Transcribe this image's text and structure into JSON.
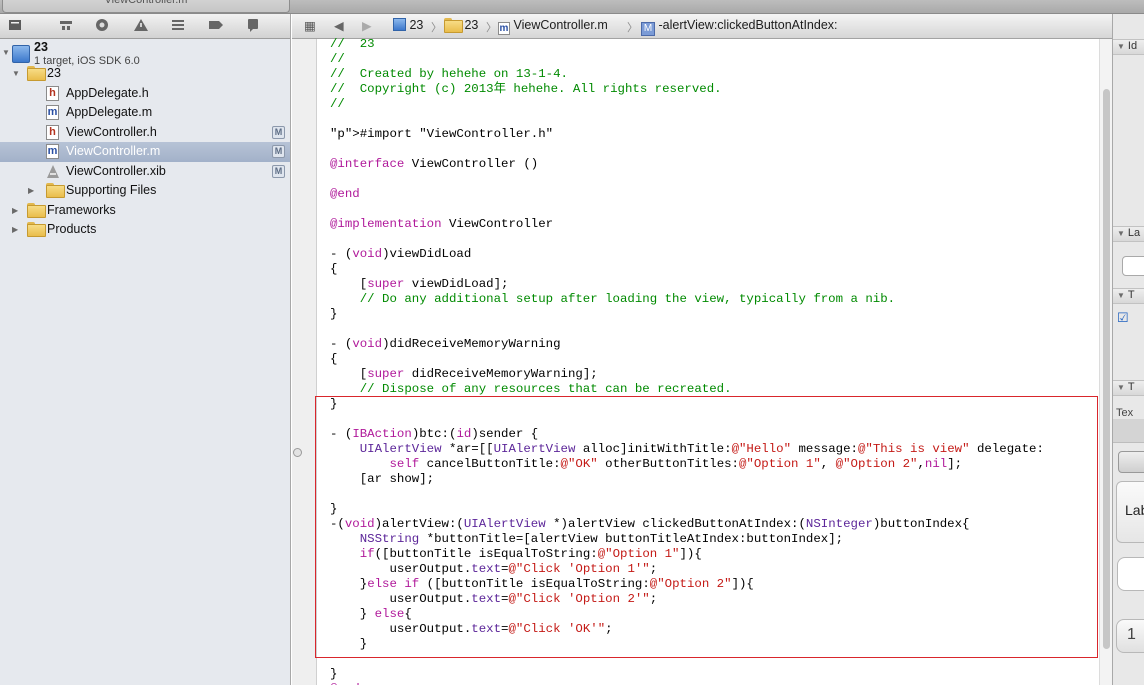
{
  "window": {
    "tab_title": "ViewController.m"
  },
  "navigator": {
    "project": {
      "name": "23",
      "subtitle": "1 target, iOS SDK 6.0"
    },
    "items": [
      {
        "label": "23",
        "kind": "folder",
        "badge": ""
      },
      {
        "label": "AppDelegate.h",
        "kind": "h",
        "badge": ""
      },
      {
        "label": "AppDelegate.m",
        "kind": "m",
        "badge": ""
      },
      {
        "label": "ViewController.h",
        "kind": "h",
        "badge": "M"
      },
      {
        "label": "ViewController.m",
        "kind": "m",
        "badge": "M"
      },
      {
        "label": "ViewController.xib",
        "kind": "xib",
        "badge": "M"
      },
      {
        "label": "Supporting Files",
        "kind": "folder",
        "badge": ""
      },
      {
        "label": "Frameworks",
        "kind": "folder",
        "badge": ""
      },
      {
        "label": "Products",
        "kind": "folder",
        "badge": ""
      }
    ]
  },
  "jumpbar": {
    "items": [
      "23",
      "23",
      "ViewController.m",
      "-alertView:clickedButtonAtIndex:"
    ],
    "method_badge": "M"
  },
  "editor": {
    "code_lines": [
      "//  23",
      "//",
      "//  Created by hehehe on 13-1-4.",
      "//  Copyright (c) 2013年 hehehe. All rights reserved.",
      "//",
      "",
      "#import \"ViewController.h\"",
      "",
      "@interface ViewController ()",
      "",
      "@end",
      "",
      "@implementation ViewController",
      "",
      "- (void)viewDidLoad",
      "{",
      "    [super viewDidLoad];",
      "    // Do any additional setup after loading the view, typically from a nib.",
      "}",
      "",
      "- (void)didReceiveMemoryWarning",
      "{",
      "    [super didReceiveMemoryWarning];",
      "    // Dispose of any resources that can be recreated.",
      "}",
      "",
      "- (IBAction)btc:(id)sender {",
      "    UIAlertView *ar=[[UIAlertView alloc]initWithTitle:@\"Hello\" message:@\"This is view\" delegate:",
      "        self cancelButtonTitle:@\"OK\" otherButtonTitles:@\"Option 1\", @\"Option 2\",nil];",
      "    [ar show];",
      "",
      "}",
      "-(void)alertView:(UIAlertView *)alertView clickedButtonAtIndex:(NSInteger)buttonIndex{",
      "    NSString *buttonTitle=[alertView buttonTitleAtIndex:buttonIndex];",
      "    if([buttonTitle isEqualToString:@\"Option 1\"]){",
      "        userOutput.text=@\"Click 'Option 1'\";",
      "    }else if ([buttonTitle isEqualToString:@\"Option 2\"]){",
      "        userOutput.text=@\"Click 'Option 2'\";",
      "    } else{",
      "        userOutput.text=@\"Click 'OK'\";",
      "    }",
      "",
      "}",
      "@end"
    ]
  },
  "utilities": {
    "sections": [
      "Id",
      "La",
      "T",
      "T"
    ],
    "text_label": "Tex",
    "label_button": "Lab",
    "stepper_value": "1"
  },
  "colors": {
    "comment": "#008a00",
    "keyword": "#b0199a",
    "string": "#c41a16",
    "preprocessor": "#6b3a1a",
    "class_name": "#5c2699",
    "highlight_box": "#d9262c",
    "selection": "#a2b1c9"
  }
}
